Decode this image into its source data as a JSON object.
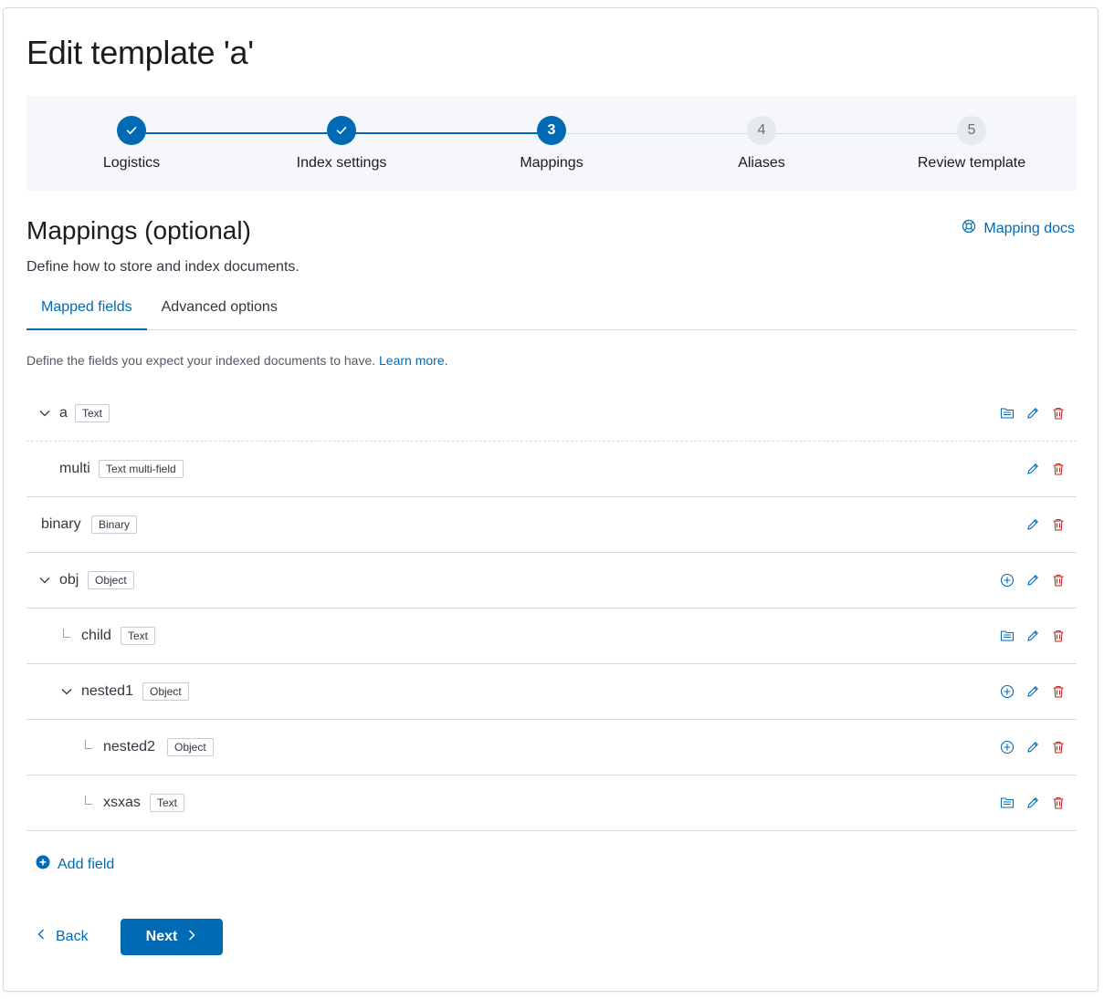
{
  "page": {
    "title": "Edit template 'a'"
  },
  "stepper": {
    "steps": [
      {
        "label": "Logistics",
        "number": "1",
        "status": "complete"
      },
      {
        "label": "Index settings",
        "number": "2",
        "status": "complete"
      },
      {
        "label": "Mappings",
        "number": "3",
        "status": "current"
      },
      {
        "label": "Aliases",
        "number": "4",
        "status": "incomplete"
      },
      {
        "label": "Review template",
        "number": "5",
        "status": "incomplete"
      }
    ]
  },
  "section": {
    "title": "Mappings (optional)",
    "description": "Define how to store and index documents.",
    "docs_link": "Mapping docs"
  },
  "tabs": [
    {
      "label": "Mapped fields",
      "active": true
    },
    {
      "label": "Advanced options",
      "active": false
    }
  ],
  "helper": {
    "text": "Define the fields you expect your indexed documents to have.",
    "link": "Learn more."
  },
  "fields": [
    {
      "name": "a",
      "type": "Text",
      "depth": 0,
      "expandable": true,
      "actions": [
        "multi-field",
        "edit",
        "delete"
      ]
    },
    {
      "name": "multi",
      "type": "Text multi-field",
      "depth": 0,
      "multifield": true,
      "actions": [
        "edit",
        "delete"
      ]
    },
    {
      "name": "binary",
      "type": "Binary",
      "depth": 0,
      "actions": [
        "edit",
        "delete"
      ]
    },
    {
      "name": "obj",
      "type": "Object",
      "depth": 0,
      "expandable": true,
      "actions": [
        "add-child",
        "edit",
        "delete"
      ]
    },
    {
      "name": "child",
      "type": "Text",
      "depth": 1,
      "actions": [
        "multi-field",
        "edit",
        "delete"
      ]
    },
    {
      "name": "nested1",
      "type": "Object",
      "depth": 1,
      "expandable": true,
      "actions": [
        "add-child",
        "edit",
        "delete"
      ]
    },
    {
      "name": "nested2",
      "type": "Object",
      "depth": 2,
      "actions": [
        "add-child",
        "edit",
        "delete"
      ]
    },
    {
      "name": "xsxas",
      "type": "Text",
      "depth": 2,
      "actions": [
        "multi-field",
        "edit",
        "delete"
      ]
    }
  ],
  "add_field": "Add field",
  "footer": {
    "back": "Back",
    "next": "Next"
  },
  "colors": {
    "primary": "#006bb4",
    "danger": "#bd271e",
    "step_todo_bg": "#e6e9ee"
  }
}
